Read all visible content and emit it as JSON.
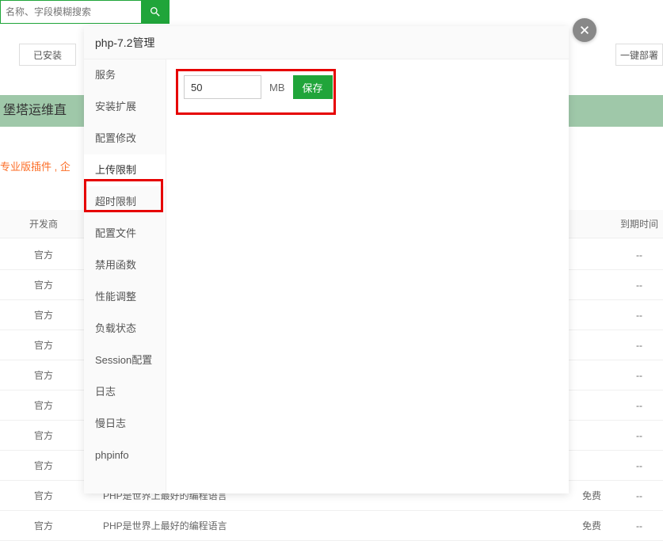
{
  "search": {
    "placeholder": "名称、字段模糊搜索"
  },
  "buttons": {
    "installed": "已安装",
    "deploy": "一键部署"
  },
  "banner": {
    "text": "堡塔运维直"
  },
  "promo": {
    "text": "专业版插件 , 企"
  },
  "table": {
    "headers": {
      "dev": "开发商",
      "expire": "到期时间"
    },
    "rows": [
      {
        "dev": "官方",
        "desc": "",
        "price": "",
        "expire": "--"
      },
      {
        "dev": "官方",
        "desc": "",
        "price": "",
        "expire": "--"
      },
      {
        "dev": "官方",
        "desc": "",
        "price": "",
        "expire": "--"
      },
      {
        "dev": "官方",
        "desc": "",
        "price": "",
        "expire": "--"
      },
      {
        "dev": "官方",
        "desc": "",
        "price": "",
        "expire": "--"
      },
      {
        "dev": "官方",
        "desc": "",
        "price": "",
        "expire": "--"
      },
      {
        "dev": "官方",
        "desc": "",
        "price": "",
        "expire": "--"
      },
      {
        "dev": "官方",
        "desc": "",
        "price": "",
        "expire": "--"
      },
      {
        "dev": "官方",
        "desc": "PHP是世界上最好的编程语言",
        "price": "免费",
        "expire": "--"
      },
      {
        "dev": "官方",
        "desc": "PHP是世界上最好的编程语言",
        "price": "免费",
        "expire": "--"
      }
    ]
  },
  "modal": {
    "title": "php-7.2管理",
    "sidebar": {
      "items": [
        {
          "label": "服务"
        },
        {
          "label": "安装扩展"
        },
        {
          "label": "配置修改"
        },
        {
          "label": "上传限制"
        },
        {
          "label": "超时限制"
        },
        {
          "label": "配置文件"
        },
        {
          "label": "禁用函数"
        },
        {
          "label": "性能调整"
        },
        {
          "label": "负载状态"
        },
        {
          "label": "Session配置"
        },
        {
          "label": "日志"
        },
        {
          "label": "慢日志"
        },
        {
          "label": "phpinfo"
        }
      ]
    },
    "content": {
      "value": "50",
      "unit": "MB",
      "save": "保存"
    }
  },
  "colors": {
    "accent": "#20a53a",
    "highlight": "#e60000"
  }
}
